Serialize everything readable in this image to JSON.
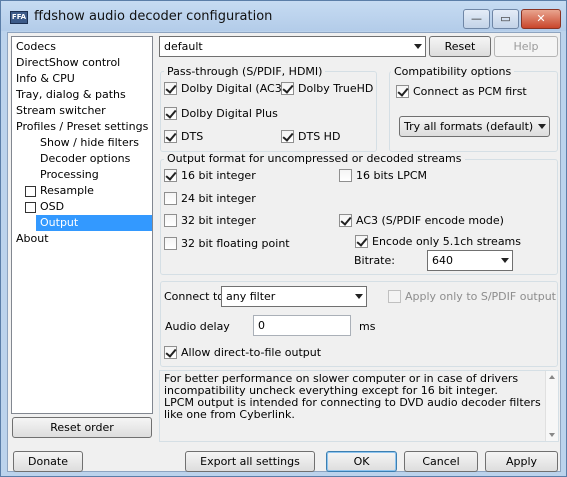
{
  "window": {
    "app_icon_text": "FFA",
    "title": "ffdshow audio decoder configuration",
    "minimize_glyph": "—",
    "maximize_glyph": "▭",
    "close_glyph": "✕"
  },
  "tree": {
    "items": [
      {
        "label": "Codecs"
      },
      {
        "label": "DirectShow control"
      },
      {
        "label": "Info & CPU"
      },
      {
        "label": "Tray, dialog & paths"
      },
      {
        "label": "Stream switcher"
      },
      {
        "label": "Profiles / Preset settings"
      },
      {
        "label": "Show / hide filters"
      },
      {
        "label": "Decoder options"
      },
      {
        "label": "Processing"
      },
      {
        "label": "Resample",
        "checked": false
      },
      {
        "label": "OSD",
        "checked": false
      },
      {
        "label": "Output",
        "selected": true
      },
      {
        "label": "About"
      }
    ],
    "reset_order_label": "Reset order"
  },
  "preset": {
    "value": "default",
    "reset_label": "Reset",
    "help_label": "Help"
  },
  "passthrough": {
    "title": "Pass-through (S/PDIF, HDMI)",
    "ac3": {
      "label": "Dolby Digital (AC3)",
      "checked": true
    },
    "truehd": {
      "label": "Dolby TrueHD",
      "checked": true
    },
    "ddplus": {
      "label": "Dolby Digital Plus",
      "checked": true
    },
    "dts": {
      "label": "DTS",
      "checked": true
    },
    "dtshd": {
      "label": "DTS HD",
      "checked": true
    }
  },
  "compat": {
    "title": "Compatibility options",
    "pcm": {
      "label": "Connect as PCM first",
      "checked": true
    },
    "formats": "Try all formats (default)"
  },
  "output_format": {
    "title": "Output format for uncompressed or decoded streams",
    "int16": {
      "label": "16 bit integer",
      "checked": true
    },
    "lpcm16": {
      "label": "16 bits LPCM",
      "checked": false
    },
    "int24": {
      "label": "24 bit integer",
      "checked": false
    },
    "int32": {
      "label": "32 bit integer",
      "checked": false
    },
    "ac3enc": {
      "label": "AC3 (S/PDIF encode mode)",
      "checked": true
    },
    "float32": {
      "label": "32 bit floating point",
      "checked": false
    },
    "only51": {
      "label": "Encode only 5.1ch streams",
      "checked": true
    },
    "bitrate_label": "Bitrate:",
    "bitrate_value": "640"
  },
  "connect": {
    "label": "Connect to:",
    "value": "any filter",
    "spdif_only": {
      "label": "Apply only to S/PDIF output",
      "checked": false
    },
    "delay_label": "Audio delay",
    "delay_value": "0",
    "delay_unit": "ms",
    "direct_file": {
      "label": "Allow direct-to-file output",
      "checked": true
    }
  },
  "info_text": "For better performance on slower computer or in case of drivers incompatibility uncheck everything except for 16 bit integer.\nLPCM output is intended for connecting to DVD audio decoder filters like one from Cyberlink.",
  "footer": {
    "donate": "Donate",
    "export": "Export all settings",
    "ok": "OK",
    "cancel": "Cancel",
    "apply": "Apply"
  }
}
